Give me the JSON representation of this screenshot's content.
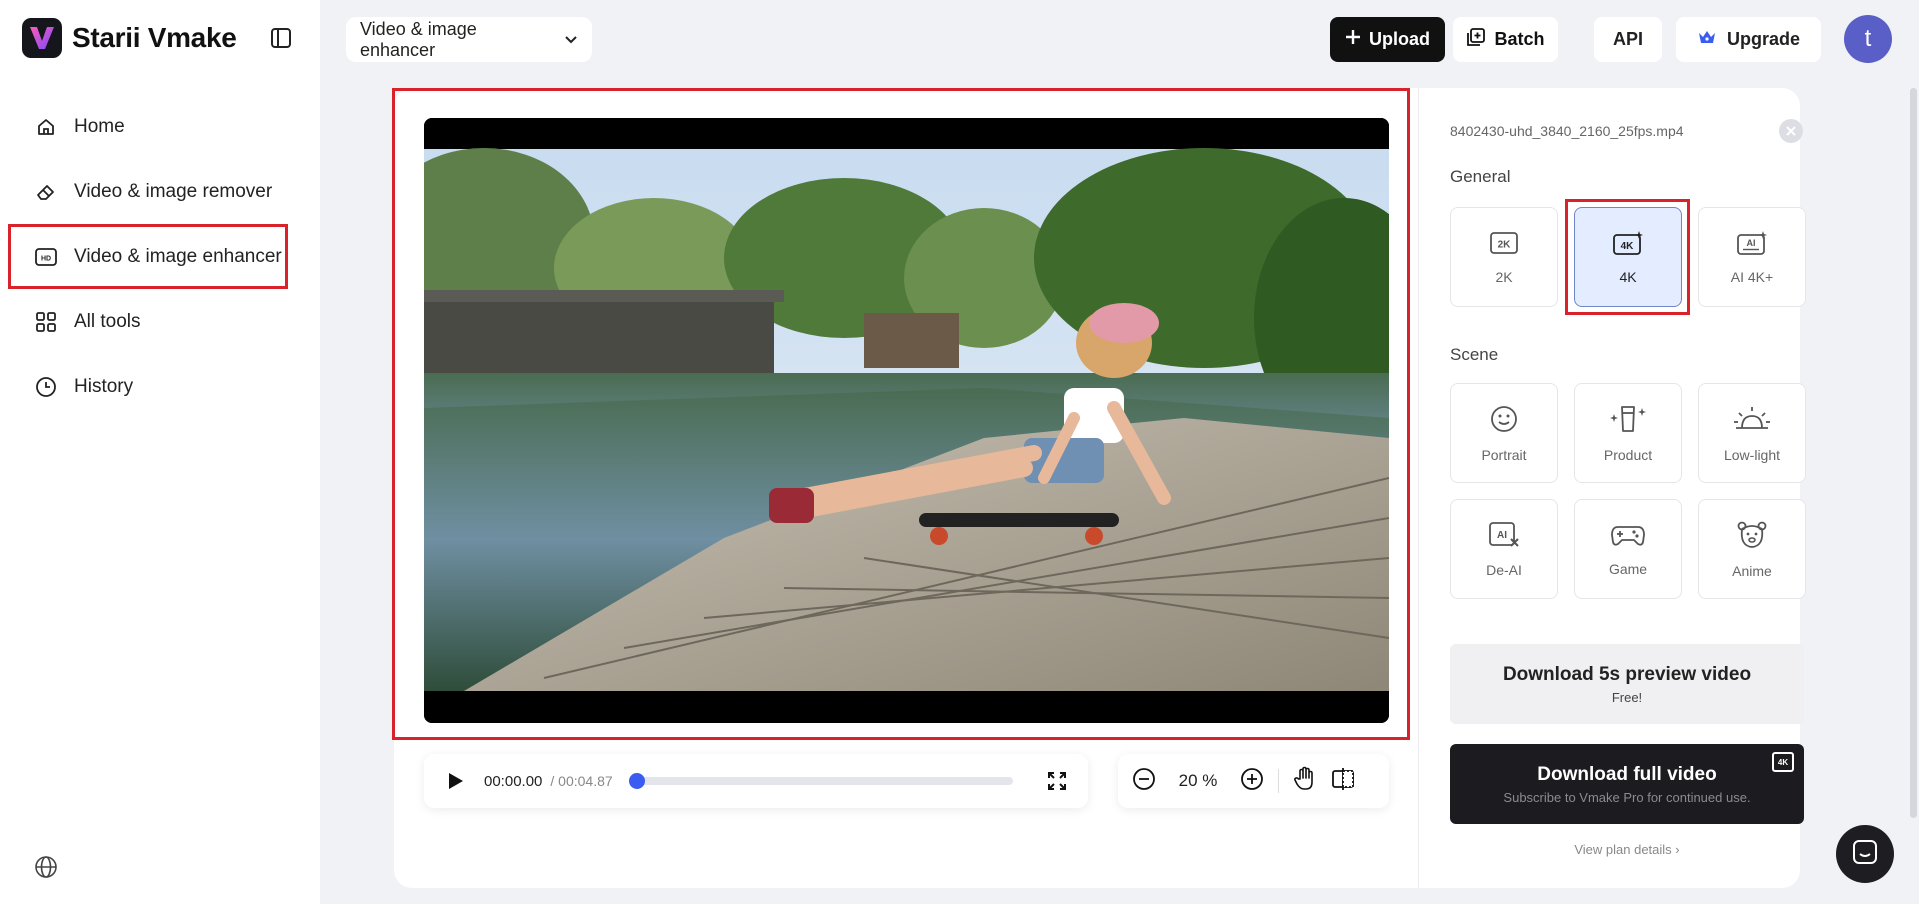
{
  "app": {
    "name": "Starii Vmake"
  },
  "sidebar": {
    "items": [
      {
        "label": "Home",
        "icon": "home-icon"
      },
      {
        "label": "Video & image remover",
        "icon": "eraser-icon"
      },
      {
        "label": "Video & image enhancer",
        "icon": "hd-icon",
        "active": true
      },
      {
        "label": "All tools",
        "icon": "grid-icon"
      },
      {
        "label": "History",
        "icon": "clock-icon"
      }
    ]
  },
  "topbar": {
    "tool_select": "Video & image enhancer",
    "upload": "Upload",
    "batch": "Batch",
    "api": "API",
    "upgrade": "Upgrade",
    "avatar_letter": "t"
  },
  "player": {
    "current_time": "00:00.00",
    "duration": "/ 00:04.87",
    "progress": 0,
    "zoom": "20 %"
  },
  "panel": {
    "filename": "8402430-uhd_3840_2160_25fps.mp4",
    "general_label": "General",
    "general_options": [
      {
        "label": "2K",
        "icon": "2k-icon"
      },
      {
        "label": "4K",
        "icon": "4k-icon",
        "selected": true
      },
      {
        "label": "AI 4K+",
        "icon": "ai-4k-icon"
      }
    ],
    "scene_label": "Scene",
    "scene_options": [
      {
        "label": "Portrait",
        "icon": "smile-icon"
      },
      {
        "label": "Product",
        "icon": "product-icon"
      },
      {
        "label": "Low-light",
        "icon": "sunrise-icon"
      },
      {
        "label": "De-AI",
        "icon": "de-ai-icon"
      },
      {
        "label": "Game",
        "icon": "gamepad-icon"
      },
      {
        "label": "Anime",
        "icon": "bear-icon"
      }
    ],
    "download_preview": {
      "title": "Download 5s preview video",
      "sub": "Free!"
    },
    "download_full": {
      "title": "Download full video",
      "sub": "Subscribe to Vmake Pro for continued use.",
      "badge": "4K"
    },
    "plan_link": "View plan details"
  },
  "colors": {
    "accent": "#3b5cf0",
    "highlight": "#d9232a",
    "selected_bg": "#e4edff"
  }
}
